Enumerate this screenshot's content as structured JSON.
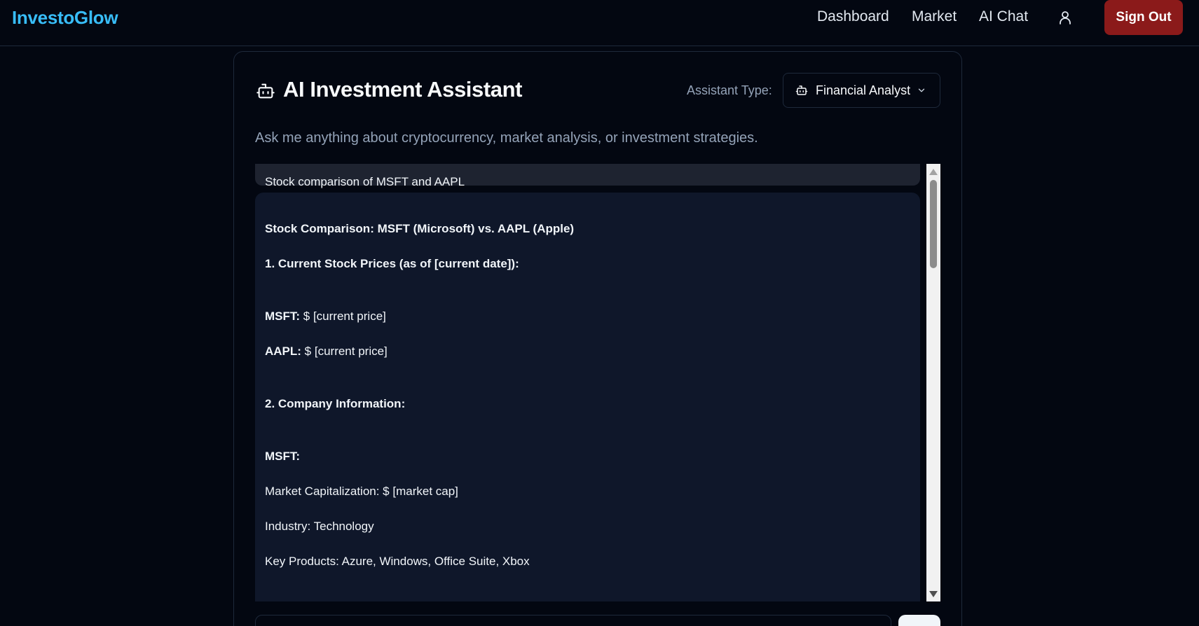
{
  "brand": "InvestoGlow",
  "nav": {
    "dashboard": "Dashboard",
    "market": "Market",
    "ai_chat": "AI Chat",
    "user_icon": "user-icon",
    "sign_out": "Sign Out"
  },
  "assistant": {
    "title": "AI Investment Assistant",
    "title_icon": "bot-icon",
    "type_label": "Assistant Type:",
    "type_value": "Financial Analyst",
    "subtitle": "Ask me anything about cryptocurrency, market analysis, or investment strategies."
  },
  "chat": {
    "user_message": "Stock comparison of MSFT and AAPL",
    "ai_heading": "Stock Comparison: MSFT (Microsoft) vs. AAPL (Apple)",
    "section1": "1. Current Stock Prices (as of [current date]):",
    "msft_price_label": "MSFT:",
    "msft_price_value": " $ [current price]",
    "aapl_price_label": "AAPL:",
    "aapl_price_value": " $ [current price]",
    "section2": "2. Company Information:",
    "msft_label": "MSFT:",
    "market_cap": "Market Capitalization: $ [market cap]",
    "industry": "Industry: Technology",
    "key_products": "Key Products: Azure, Windows, Office Suite, Xbox"
  },
  "colors": {
    "background": "#030711",
    "brand": "#38bdf8",
    "sign_out": "#8b1a1a",
    "ai_bubble": "#0f172a"
  }
}
